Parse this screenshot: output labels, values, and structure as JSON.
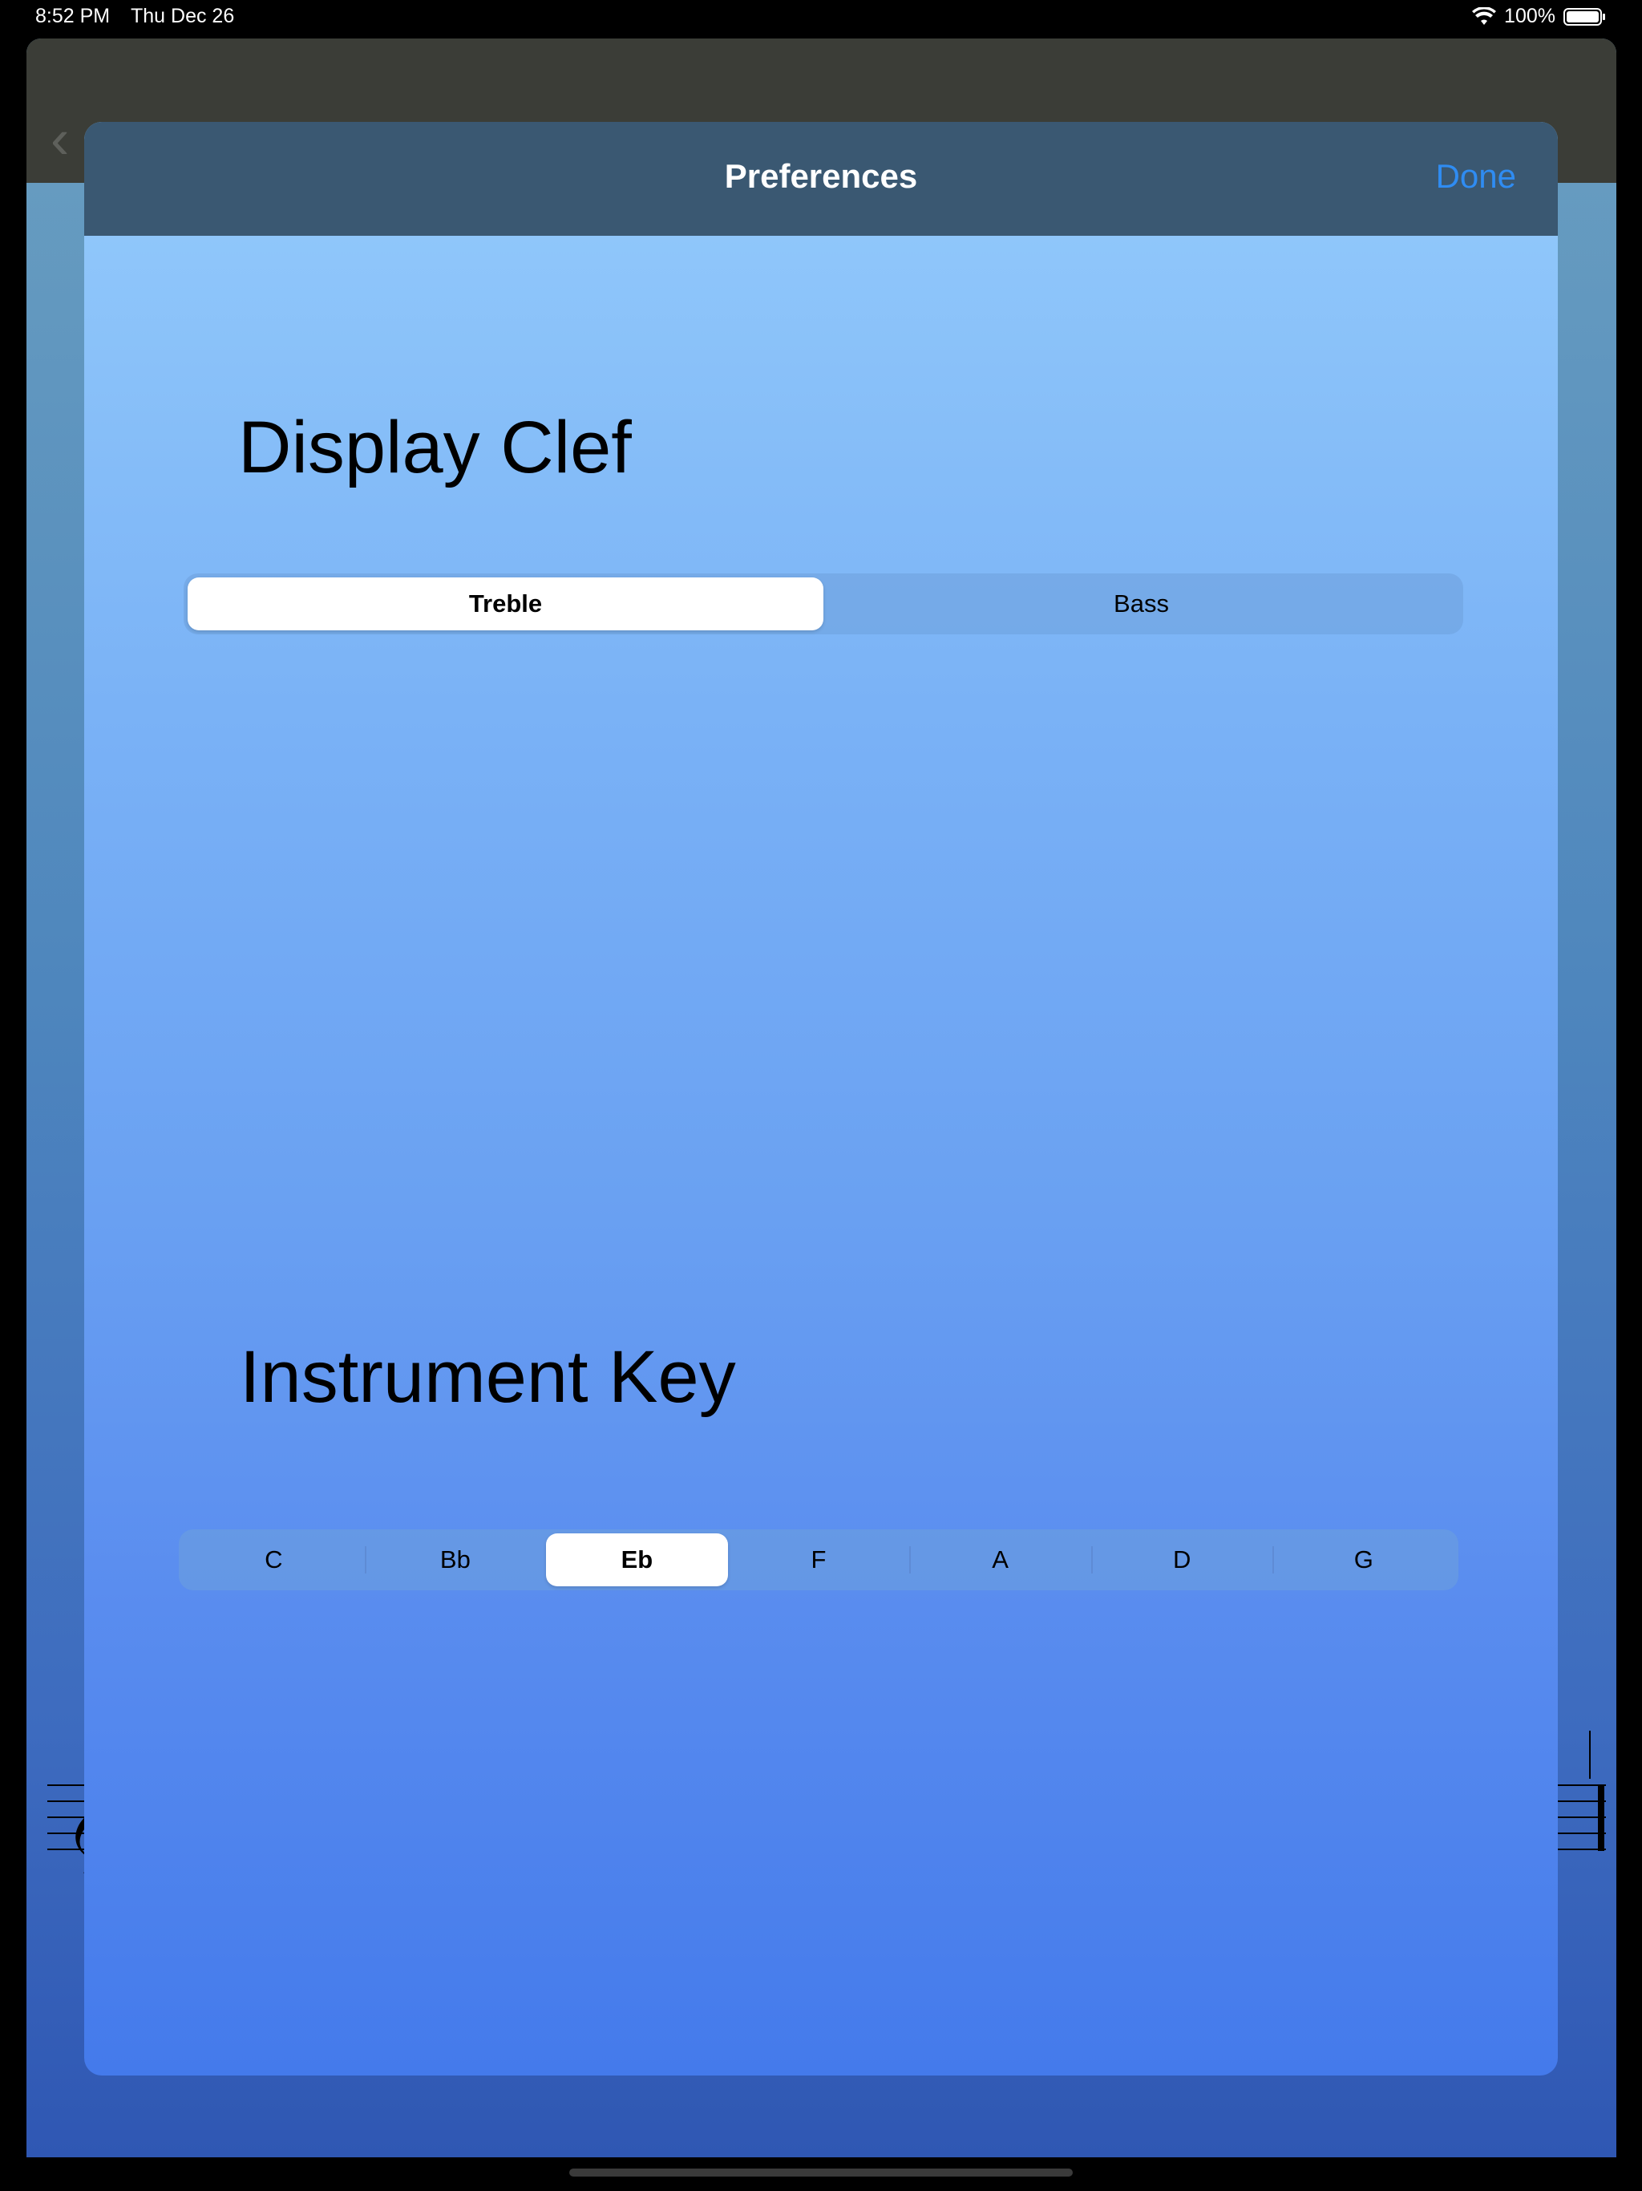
{
  "status_bar": {
    "time": "8:52 PM",
    "date": "Thu Dec 26",
    "battery": "100%"
  },
  "background": {
    "back_label": "‹",
    "title": "",
    "right_label": ""
  },
  "modal": {
    "title": "Preferences",
    "done_label": "Done"
  },
  "display_clef": {
    "heading": "Display Clef",
    "options": [
      "Treble",
      "Bass"
    ],
    "selected": "Treble"
  },
  "instrument_key": {
    "heading": "Instrument Key",
    "options": [
      "C",
      "Bb",
      "Eb",
      "F",
      "A",
      "D",
      "G"
    ],
    "selected": "Eb"
  },
  "colors": {
    "header": "#3a5872",
    "accent": "#2f8cf2",
    "gradient_top": "#94cbfb",
    "gradient_bottom": "#447aeb"
  },
  "icons": [
    "wifi-icon",
    "battery-icon",
    "treble-clef-icon",
    "back-chevron-icon"
  ]
}
